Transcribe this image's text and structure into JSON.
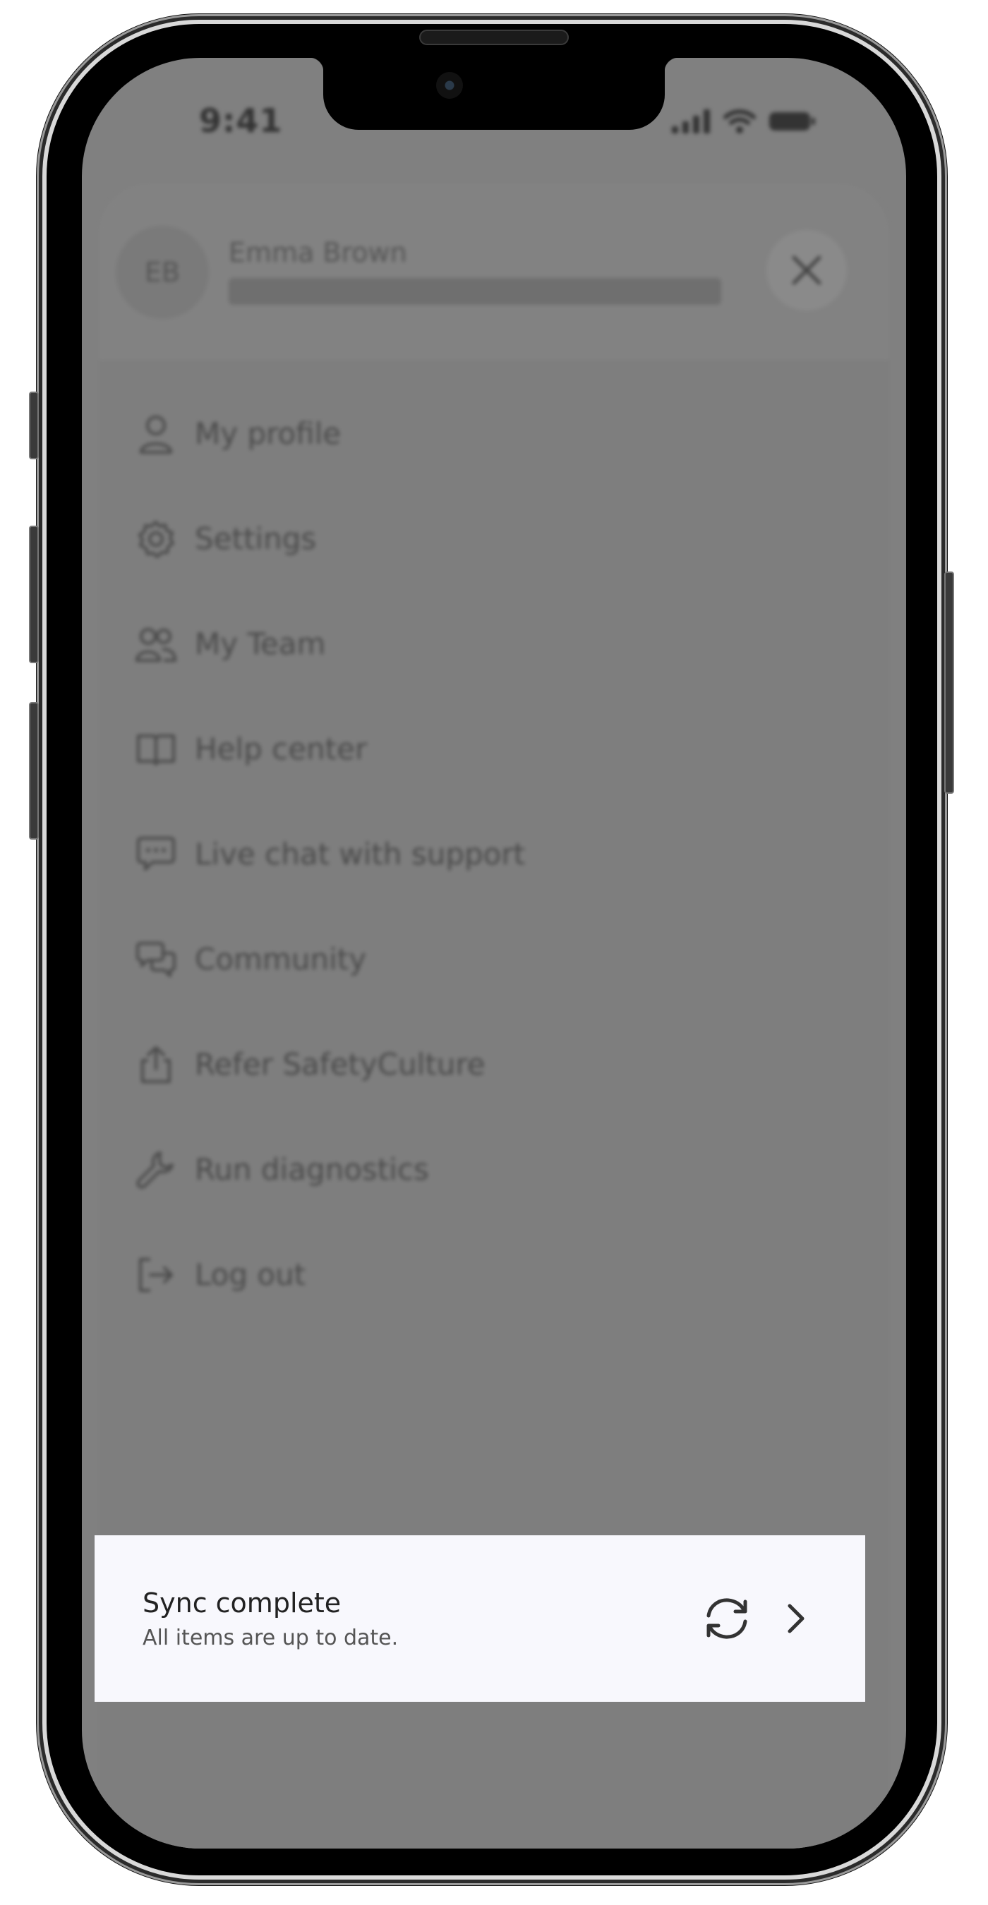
{
  "status_bar": {
    "time": "9:41"
  },
  "user": {
    "initials": "EB",
    "name": "Emma Brown"
  },
  "menu": {
    "items": [
      {
        "label": "My profile",
        "icon": "user-icon"
      },
      {
        "label": "Settings",
        "icon": "gear-icon"
      },
      {
        "label": "My Team",
        "icon": "team-icon"
      },
      {
        "label": "Help center",
        "icon": "book-icon"
      },
      {
        "label": "Live chat with support",
        "icon": "chat-icon"
      },
      {
        "label": "Community",
        "icon": "community-icon"
      },
      {
        "label": "Refer SafetyCulture",
        "icon": "share-icon"
      },
      {
        "label": "Run diagnostics",
        "icon": "wrench-icon"
      },
      {
        "label": "Log out",
        "icon": "logout-icon"
      }
    ]
  },
  "sync": {
    "title": "Sync complete",
    "subtitle": "All items are up to date."
  },
  "colors": {
    "overlay": "#808080",
    "banner": "#f8f8fd",
    "frame": "#000000"
  }
}
